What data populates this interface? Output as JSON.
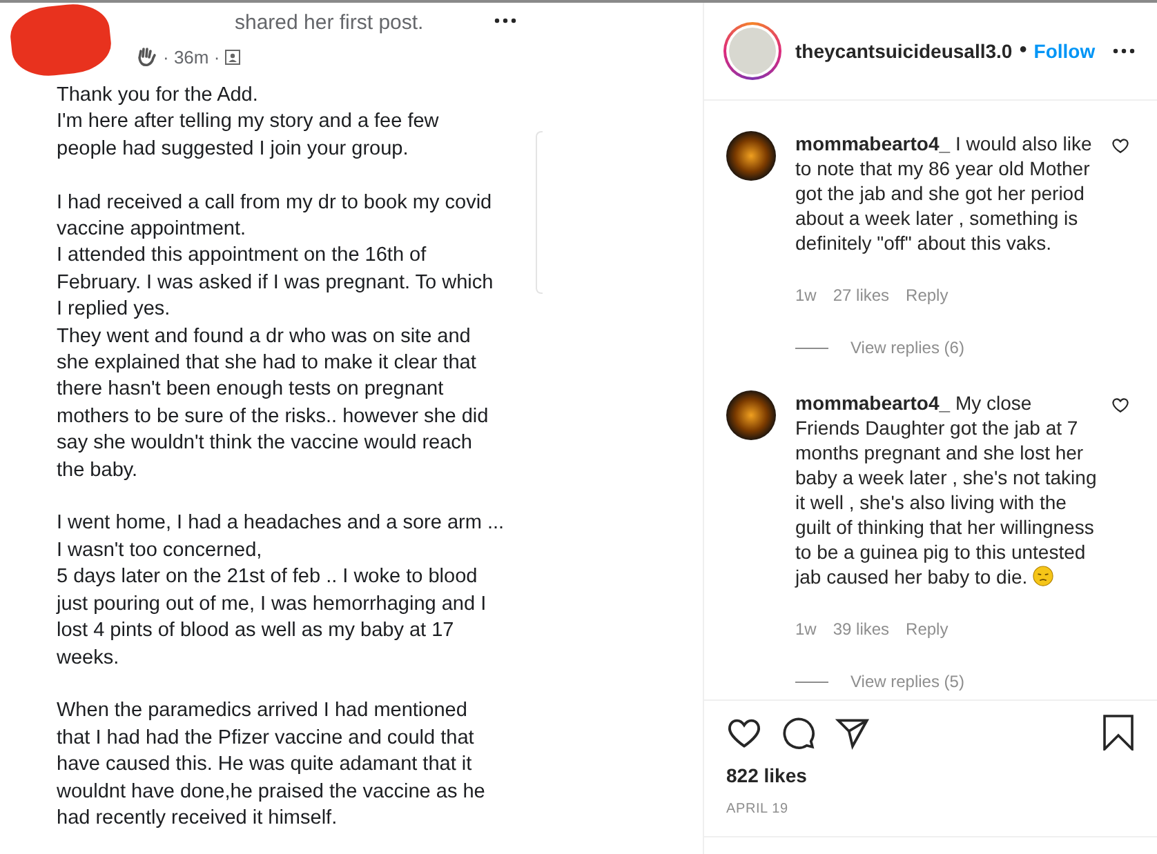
{
  "post_image": {
    "header_text": "shared her first post.",
    "time": "· 36m ·",
    "paragraphs": [
      [
        "Thank you for the Add.",
        "I'm here after telling my story and a fee few",
        "people had suggested I join your group."
      ],
      [
        "I had received a call from my dr to book my covid",
        "vaccine appointment.",
        "I attended this appointment on the 16th of",
        "February. I was asked if I was pregnant. To which",
        "I replied yes.",
        "They went and found a dr who was on site and",
        "she explained that she had to make it clear that",
        "there hasn't been enough tests on pregnant",
        "mothers to be sure of the risks.. however she did",
        "say she wouldn't think the vaccine would  reach",
        "the baby."
      ],
      [
        "I went home, I had a headaches and a sore arm ...",
        "I wasn't too concerned,",
        "5 days later on the 21st of feb .. I woke to blood",
        "just pouring out of me, I was hemorrhaging and I",
        "lost 4 pints of blood as well as my baby at 17",
        "weeks."
      ],
      [
        "When the paramedics arrived I had mentioned",
        "that I had had the Pfizer vaccine and could that",
        "have caused this. He was quite adamant that it",
        "wouldnt have done,he praised the vaccine as he",
        "had recently received it himself."
      ]
    ]
  },
  "account": {
    "username": "theycantsuicideusall3.0",
    "separator": "•",
    "follow": "Follow"
  },
  "comments": [
    {
      "username": "mommabearto4_",
      "text": "I would also like to note that my 86 year old Mother got the jab and she got her period about a week later , something is definitely \"off\" about this vaks.",
      "emoji": false,
      "time": "1w",
      "likes": "27 likes",
      "reply": "Reply",
      "view_replies": "View replies (6)"
    },
    {
      "username": "mommabearto4_",
      "text": "My close Friends Daughter got the jab at 7 months pregnant and she lost her baby a week later , she's not taking it well , she's also living with the guilt of thinking that her willingness to be a guinea pig to this untested jab caused her baby to die.",
      "emoji": true,
      "time": "1w",
      "likes": "39 likes",
      "reply": "Reply",
      "view_replies": "View replies (5)"
    }
  ],
  "likes": "822 likes",
  "date": "APRIL 19"
}
